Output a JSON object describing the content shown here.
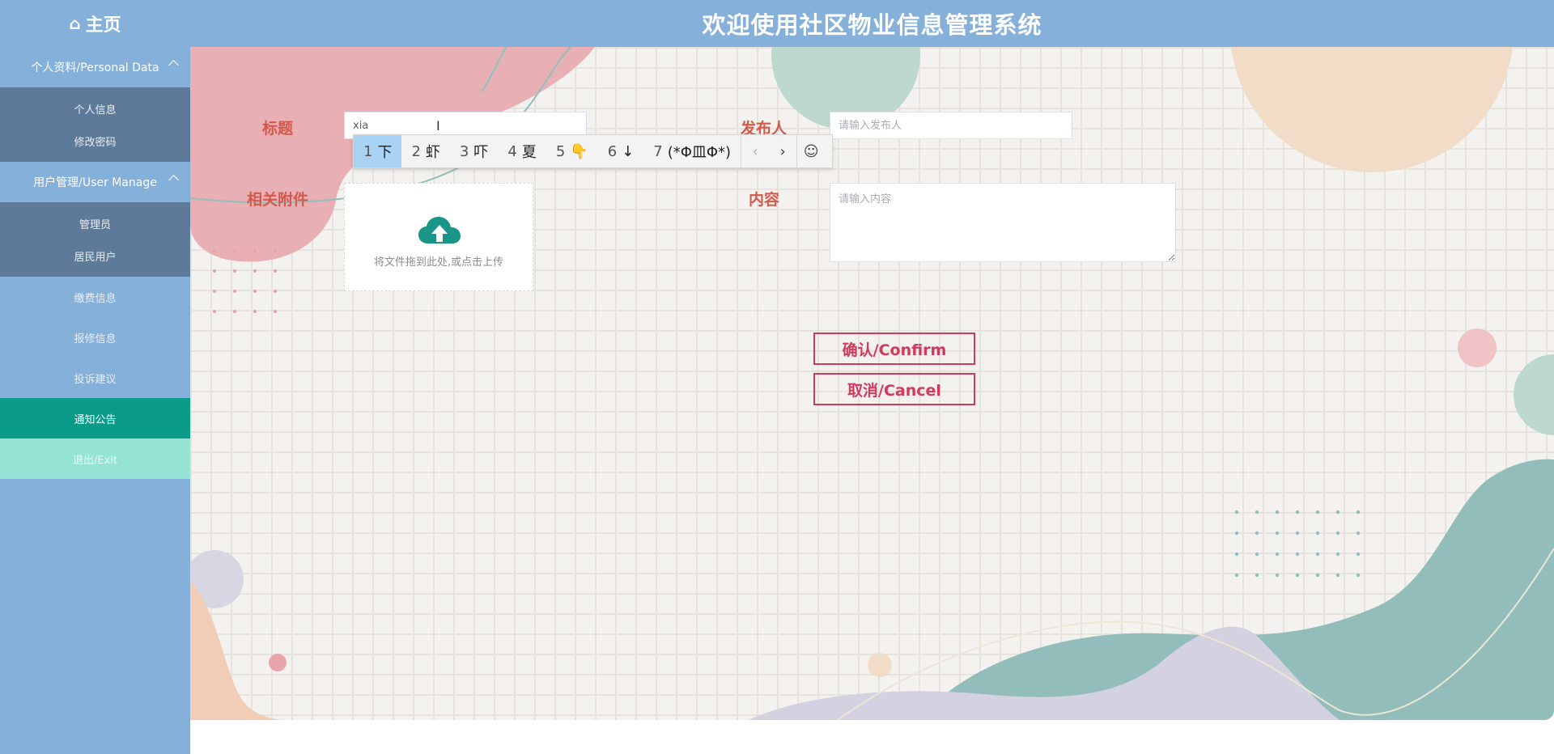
{
  "header": {
    "home_label": "主页",
    "title": "欢迎使用社区物业信息管理系统"
  },
  "sidebar": {
    "groups": [
      {
        "title": "个人资料/Personal Data",
        "items": [
          "个人信息",
          "修改密码"
        ]
      },
      {
        "title": "用户管理/User Manage",
        "items": [
          "管理员",
          "居民用户"
        ]
      }
    ],
    "items": [
      "缴费信息",
      "报修信息",
      "投诉建议",
      "通知公告",
      "退出/Exit"
    ],
    "active_item": "通知公告"
  },
  "form": {
    "title_label": "标题",
    "title_value": "xia",
    "publisher_label": "发布人",
    "publisher_placeholder": "请输入发布人",
    "attachment_label": "相关附件",
    "upload_text": "将文件拖到此处,或点击上传",
    "content_label": "内容",
    "content_placeholder": "请输入内容",
    "confirm_label": "确认/Confirm",
    "cancel_label": "取消/Cancel"
  },
  "ime": {
    "candidates": [
      {
        "num": "1",
        "text": "下"
      },
      {
        "num": "2",
        "text": "虾"
      },
      {
        "num": "3",
        "text": "吓"
      },
      {
        "num": "4",
        "text": "夏"
      },
      {
        "num": "5",
        "text": "👇"
      },
      {
        "num": "6",
        "text": "↓"
      },
      {
        "num": "7",
        "text": "(*Φ皿Φ*)"
      }
    ],
    "selected_index": 0
  },
  "colors": {
    "header_bg": "#84b0da",
    "submenu_bg": "#5d7a99",
    "active_bg": "#0a9b88",
    "exit_bg": "#95e3d4",
    "label": "#d4594c",
    "button": "#d03a5c"
  }
}
